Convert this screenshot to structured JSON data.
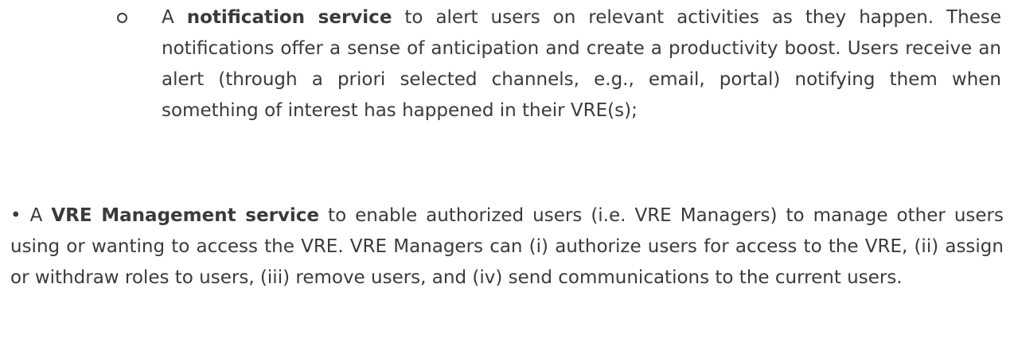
{
  "sub_item": {
    "bullet": "○",
    "lead": "A ",
    "bold": "notification service",
    "text": " to alert users on relevant activities as they happen. These notifications offer a sense of anticipation and create a productivity boost. Users receive an alert (through a priori selected channels, e.g., email, portal) notifying them when something of interest has happened in their VRE(s);"
  },
  "main_item": {
    "bullet": "•",
    "lead": " A ",
    "bold": "VRE Management service",
    "text": " to enable authorized users (i.e. VRE Managers) to manage other users using or wanting to access the VRE. VRE Managers can (i) authorize users for access to the VRE, (ii) assign or withdraw roles to users, (iii) remove users, and (iv) send communications to the current users."
  }
}
